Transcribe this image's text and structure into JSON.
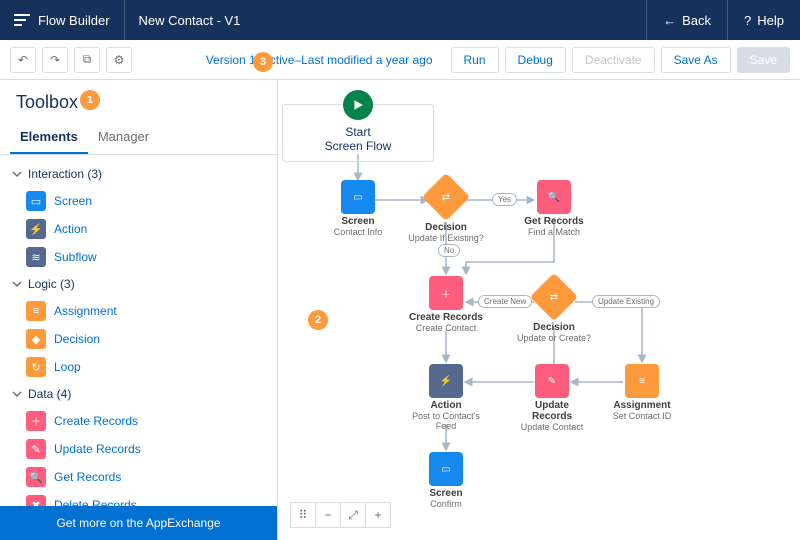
{
  "header": {
    "brand": "Flow Builder",
    "title": "New Contact - V1",
    "back": "Back",
    "help": "Help"
  },
  "toolbar_icons": [
    "undo",
    "redo",
    "copy",
    "settings"
  ],
  "version_text": "Version 1: Active–Last modified a year ago",
  "buttons": {
    "run": "Run",
    "debug": "Debug",
    "deactivate": "Deactivate",
    "save_as": "Save As",
    "save": "Save"
  },
  "toolbox": {
    "title": "Toolbox",
    "tabs": [
      "Elements",
      "Manager"
    ],
    "groups": [
      {
        "label": "Interaction (3)",
        "items": [
          {
            "label": "Screen",
            "color": "c-blue",
            "glyph": "▭"
          },
          {
            "label": "Action",
            "color": "c-navy",
            "glyph": "⚡"
          },
          {
            "label": "Subflow",
            "color": "c-navy",
            "glyph": "≋"
          }
        ]
      },
      {
        "label": "Logic (3)",
        "items": [
          {
            "label": "Assignment",
            "color": "c-orange",
            "glyph": "≡"
          },
          {
            "label": "Decision",
            "color": "c-orange",
            "glyph": "◆"
          },
          {
            "label": "Loop",
            "color": "c-orange",
            "glyph": "↻"
          }
        ]
      },
      {
        "label": "Data (4)",
        "items": [
          {
            "label": "Create Records",
            "color": "c-pink",
            "glyph": "＋"
          },
          {
            "label": "Update Records",
            "color": "c-pink",
            "glyph": "✎"
          },
          {
            "label": "Get Records",
            "color": "c-pink",
            "glyph": "🔍"
          },
          {
            "label": "Delete Records",
            "color": "c-pink",
            "glyph": "✖"
          }
        ]
      }
    ],
    "getmore": "Get more on the AppExchange"
  },
  "canvas": {
    "start": {
      "title": "Start",
      "sub": "Screen Flow"
    },
    "nodes": {
      "screen1": {
        "title": "Screen",
        "sub": "Contact Info",
        "color": "c-blue",
        "glyph": "▭"
      },
      "decision1": {
        "title": "Decision",
        "sub": "Update If Existing?",
        "color": "c-orange"
      },
      "getrec": {
        "title": "Get Records",
        "sub": "Find a Match",
        "color": "c-pink",
        "glyph": "🔍"
      },
      "create": {
        "title": "Create Records",
        "sub": "Create Contact",
        "color": "c-pink",
        "glyph": "＋"
      },
      "decision2": {
        "title": "Decision",
        "sub": "Update or Create?",
        "color": "c-orange"
      },
      "action": {
        "title": "Action",
        "sub": "Post to Contact's Feed",
        "color": "c-navy",
        "glyph": "⚡"
      },
      "update": {
        "title": "Update Records",
        "sub": "Update Contact",
        "color": "c-pink",
        "glyph": "✎"
      },
      "assign": {
        "title": "Assignment",
        "sub": "Set Contact ID",
        "color": "c-orange",
        "glyph": "≡"
      },
      "screen2": {
        "title": "Screen",
        "sub": "Confirm",
        "color": "c-blue",
        "glyph": "▭"
      }
    },
    "labels": {
      "yes": "Yes",
      "no": "No",
      "create_new": "Create New",
      "update_existing": "Update Existing"
    }
  },
  "markers": {
    "m1": "1",
    "m2": "2",
    "m3": "3"
  },
  "canvas_controls": [
    "select",
    "zoom-out",
    "fit",
    "zoom-in"
  ],
  "canvas_control_glyphs": {
    "select": "⠿",
    "zoom-out": "−",
    "fit": "⤢",
    "zoom-in": "+"
  }
}
